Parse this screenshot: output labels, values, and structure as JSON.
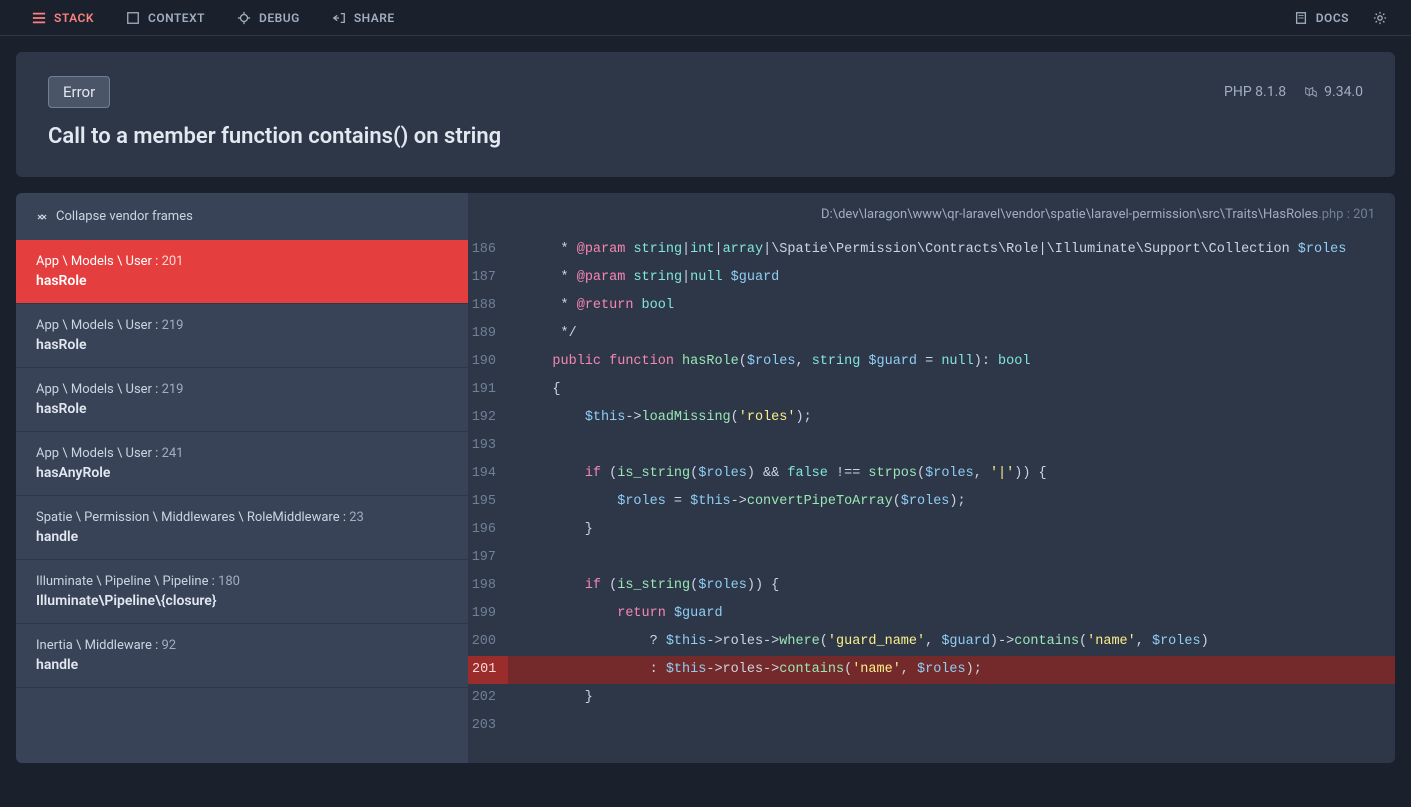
{
  "nav": {
    "stack": "STACK",
    "context": "CONTEXT",
    "debug": "DEBUG",
    "share": "SHARE",
    "docs": "DOCS"
  },
  "error": {
    "badge": "Error",
    "php_version": "PHP 8.1.8",
    "laravel_version": "9.34.0",
    "title": "Call to a member function contains() on string"
  },
  "sidebar": {
    "collapse_label": "Collapse vendor frames",
    "frames": [
      {
        "path": "App \\ Models \\ User",
        "line": "201",
        "method": "hasRole",
        "active": true
      },
      {
        "path": "App \\ Models \\ User",
        "line": "219",
        "method": "hasRole",
        "active": false
      },
      {
        "path": "App \\ Models \\ User",
        "line": "219",
        "method": "hasRole",
        "active": false
      },
      {
        "path": "App \\ Models \\ User",
        "line": "241",
        "method": "hasAnyRole",
        "active": false
      },
      {
        "path": "Spatie \\ Permission \\ Middlewares \\ RoleMiddleware",
        "line": "23",
        "method": "handle",
        "active": false
      },
      {
        "path": "Illuminate \\ Pipeline \\ Pipeline",
        "line": "180",
        "method": "Illuminate\\Pipeline\\{closure}",
        "active": false
      },
      {
        "path": "Inertia \\ Middleware",
        "line": "92",
        "method": "handle",
        "active": false
      }
    ]
  },
  "code": {
    "file_path": "D:\\dev\\laragon\\www\\qr-laravel\\vendor\\spatie\\laravel-permission\\src\\Traits\\HasRoles",
    "file_ext": ".php",
    "file_line": "201",
    "highlight_line": 201,
    "lines": [
      {
        "n": 186,
        "raw": "     * @param string|int|array|\\Spatie\\Permission\\Contracts\\Role|\\Illuminate\\Support\\Collection $roles"
      },
      {
        "n": 187,
        "raw": "     * @param string|null $guard"
      },
      {
        "n": 188,
        "raw": "     * @return bool"
      },
      {
        "n": 189,
        "raw": "     */"
      },
      {
        "n": 190,
        "raw": "    public function hasRole($roles, string $guard = null): bool"
      },
      {
        "n": 191,
        "raw": "    {"
      },
      {
        "n": 192,
        "raw": "        $this->loadMissing('roles');"
      },
      {
        "n": 193,
        "raw": ""
      },
      {
        "n": 194,
        "raw": "        if (is_string($roles) && false !== strpos($roles, '|')) {"
      },
      {
        "n": 195,
        "raw": "            $roles = $this->convertPipeToArray($roles);"
      },
      {
        "n": 196,
        "raw": "        }"
      },
      {
        "n": 197,
        "raw": ""
      },
      {
        "n": 198,
        "raw": "        if (is_string($roles)) {"
      },
      {
        "n": 199,
        "raw": "            return $guard"
      },
      {
        "n": 200,
        "raw": "                ? $this->roles->where('guard_name', $guard)->contains('name', $roles)"
      },
      {
        "n": 201,
        "raw": "                : $this->roles->contains('name', $roles);"
      },
      {
        "n": 202,
        "raw": "        }"
      },
      {
        "n": 203,
        "raw": ""
      }
    ]
  }
}
